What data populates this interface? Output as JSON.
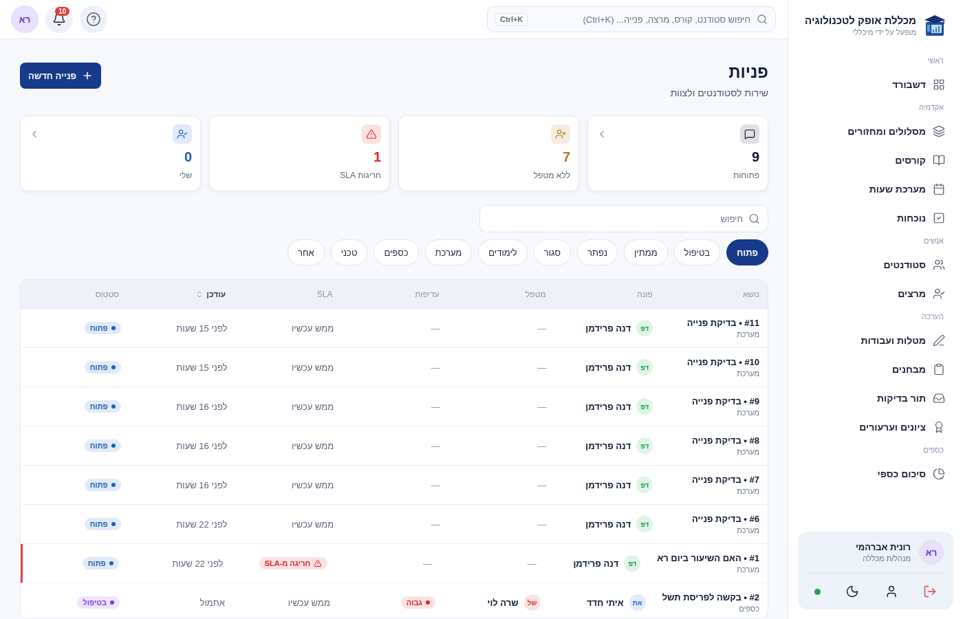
{
  "sidebar": {
    "brand": {
      "title": "מכללת אופק לטכנולוגיה",
      "subtitle": "מופעל על ידי מיכללי"
    },
    "sections": [
      {
        "heading": "ראשי",
        "items": [
          {
            "label": "דשבורד"
          }
        ]
      },
      {
        "heading": "אקדמיה",
        "items": [
          {
            "label": "מסלולים ומחזורים"
          },
          {
            "label": "קורסים"
          },
          {
            "label": "מערכת שעות"
          },
          {
            "label": "נוכחות"
          }
        ]
      },
      {
        "heading": "אנשים",
        "items": [
          {
            "label": "סטודנטים"
          },
          {
            "label": "מרצים"
          }
        ]
      },
      {
        "heading": "הערכה",
        "items": [
          {
            "label": "מטלות ועבודות"
          },
          {
            "label": "מבחנים"
          },
          {
            "label": "תור בדיקות"
          },
          {
            "label": "ציונים וערעורים"
          }
        ]
      },
      {
        "heading": "כספים",
        "items": [
          {
            "label": "סיכום כספי"
          }
        ]
      }
    ],
    "user": {
      "initials": "רא",
      "name": "רונית אברהמי",
      "role": "מנהל/ת מכללה",
      "online": true
    }
  },
  "topbar": {
    "search": {
      "placeholder": "חיפוש סטודנט, קורס, מרצה, פנייה... (Ctrl+K)",
      "shortcut": "Ctrl+K"
    },
    "notifications": "10",
    "avatar": "רא"
  },
  "page": {
    "title": "פניות",
    "subtitle": "שירות לסטודנטים ולצוות",
    "new_button": "פנייה חדשה"
  },
  "stats": [
    {
      "value": "9",
      "label": "פתוחות",
      "color": "#0f172a",
      "has_link": true
    },
    {
      "value": "7",
      "label": "ללא מטפל",
      "color": "#b7791f",
      "has_link": false
    },
    {
      "value": "1",
      "label": "חריגות SLA",
      "color": "#dc2626",
      "has_link": false
    },
    {
      "value": "0",
      "label": "שלי",
      "color": "#1d5fbf",
      "has_link": true
    }
  ],
  "filter_search": {
    "placeholder": "חיפוש"
  },
  "filters": [
    {
      "label": "פתוח",
      "selected": true
    },
    {
      "label": "בטיפול",
      "selected": false
    },
    {
      "label": "ממתין",
      "selected": false
    },
    {
      "label": "נפתר",
      "selected": false
    },
    {
      "label": "סגור",
      "selected": false
    },
    {
      "label": "לימודים",
      "selected": false
    },
    {
      "label": "מערכת",
      "selected": false
    },
    {
      "label": "כספים",
      "selected": false
    },
    {
      "label": "טכני",
      "selected": false
    },
    {
      "label": "אחר",
      "selected": false
    }
  ],
  "table": {
    "columns": [
      {
        "label": "נושא",
        "sortable": false
      },
      {
        "label": "פונה",
        "sortable": false
      },
      {
        "label": "מטפל",
        "sortable": false
      },
      {
        "label": "עדיפות",
        "sortable": false
      },
      {
        "label": "SLA",
        "sortable": false
      },
      {
        "label": "עודכן",
        "sortable": true
      },
      {
        "label": "סטטוס",
        "sortable": false
      }
    ],
    "rows": [
      {
        "title": "#11 • בדיקת פנייה",
        "category": "מערכת",
        "requester": {
          "initials": "דפ",
          "name": "דנה פרידמן",
          "color": "#16a34a"
        },
        "handler": {
          "name": "—"
        },
        "priority": {
          "kind": "none",
          "label": "—"
        },
        "sla": {
          "kind": "text",
          "text": "ממש עכשיו"
        },
        "updated": "לפני 15 שעות",
        "status": {
          "label": "פתוח",
          "color": "#1d5fbf"
        },
        "flagged": false
      },
      {
        "title": "#10 • בדיקת פנייה",
        "category": "מערכת",
        "requester": {
          "initials": "דפ",
          "name": "דנה פרידמן",
          "color": "#16a34a"
        },
        "handler": {
          "name": "—"
        },
        "priority": {
          "kind": "none",
          "label": "—"
        },
        "sla": {
          "kind": "text",
          "text": "ממש עכשיו"
        },
        "updated": "לפני 15 שעות",
        "status": {
          "label": "פתוח",
          "color": "#1d5fbf"
        },
        "flagged": false
      },
      {
        "title": "#9 • בדיקת פנייה",
        "category": "מערכת",
        "requester": {
          "initials": "דפ",
          "name": "דנה פרידמן",
          "color": "#16a34a"
        },
        "handler": {
          "name": "—"
        },
        "priority": {
          "kind": "none",
          "label": "—"
        },
        "sla": {
          "kind": "text",
          "text": "ממש עכשיו"
        },
        "updated": "לפני 16 שעות",
        "status": {
          "label": "פתוח",
          "color": "#1d5fbf"
        },
        "flagged": false
      },
      {
        "title": "#8 • בדיקת פנייה",
        "category": "מערכת",
        "requester": {
          "initials": "דפ",
          "name": "דנה פרידמן",
          "color": "#16a34a"
        },
        "handler": {
          "name": "—"
        },
        "priority": {
          "kind": "none",
          "label": "—"
        },
        "sla": {
          "kind": "text",
          "text": "ממש עכשיו"
        },
        "updated": "לפני 16 שעות",
        "status": {
          "label": "פתוח",
          "color": "#1d5fbf"
        },
        "flagged": false
      },
      {
        "title": "#7 • בדיקת פנייה",
        "category": "מערכת",
        "requester": {
          "initials": "דפ",
          "name": "דנה פרידמן",
          "color": "#16a34a"
        },
        "handler": {
          "name": "—"
        },
        "priority": {
          "kind": "none",
          "label": "—"
        },
        "sla": {
          "kind": "text",
          "text": "ממש עכשיו"
        },
        "updated": "לפני 16 שעות",
        "status": {
          "label": "פתוח",
          "color": "#1d5fbf"
        },
        "flagged": false
      },
      {
        "title": "#6 • בדיקת פנייה",
        "category": "מערכת",
        "requester": {
          "initials": "דפ",
          "name": "דנה פרידמן",
          "color": "#16a34a"
        },
        "handler": {
          "name": "—"
        },
        "priority": {
          "kind": "none",
          "label": "—"
        },
        "sla": {
          "kind": "text",
          "text": "ממש עכשיו"
        },
        "updated": "לפני 22 שעות",
        "status": {
          "label": "פתוח",
          "color": "#1d5fbf"
        },
        "flagged": false
      },
      {
        "title": "#1 • האם השיעור ביום רא",
        "category": "מערכת",
        "requester": {
          "initials": "דפ",
          "name": "דנה פרידמן",
          "color": "#16a34a"
        },
        "handler": {
          "name": "—"
        },
        "priority": {
          "kind": "none",
          "label": "—"
        },
        "sla": {
          "kind": "breach",
          "text": "חריגה מ-SLA"
        },
        "updated": "לפני 22 שעות",
        "status": {
          "label": "פתוח",
          "color": "#1d5fbf"
        },
        "flagged": true
      },
      {
        "title": "#2 • בקשה לפריסת תשל",
        "category": "כספים",
        "requester": {
          "initials": "את",
          "name": "איתי חדד",
          "color": "#2563eb"
        },
        "handler": {
          "initials": "של",
          "name": "שרה לוי",
          "color": "#dc2626"
        },
        "priority": {
          "kind": "tag",
          "label": "גבוה",
          "color": "#dc2626"
        },
        "sla": {
          "kind": "text",
          "text": "ממש עכשיו"
        },
        "updated": "אתמול",
        "status": {
          "label": "בטיפול",
          "color": "#7c3aed"
        },
        "flagged": false
      }
    ]
  }
}
